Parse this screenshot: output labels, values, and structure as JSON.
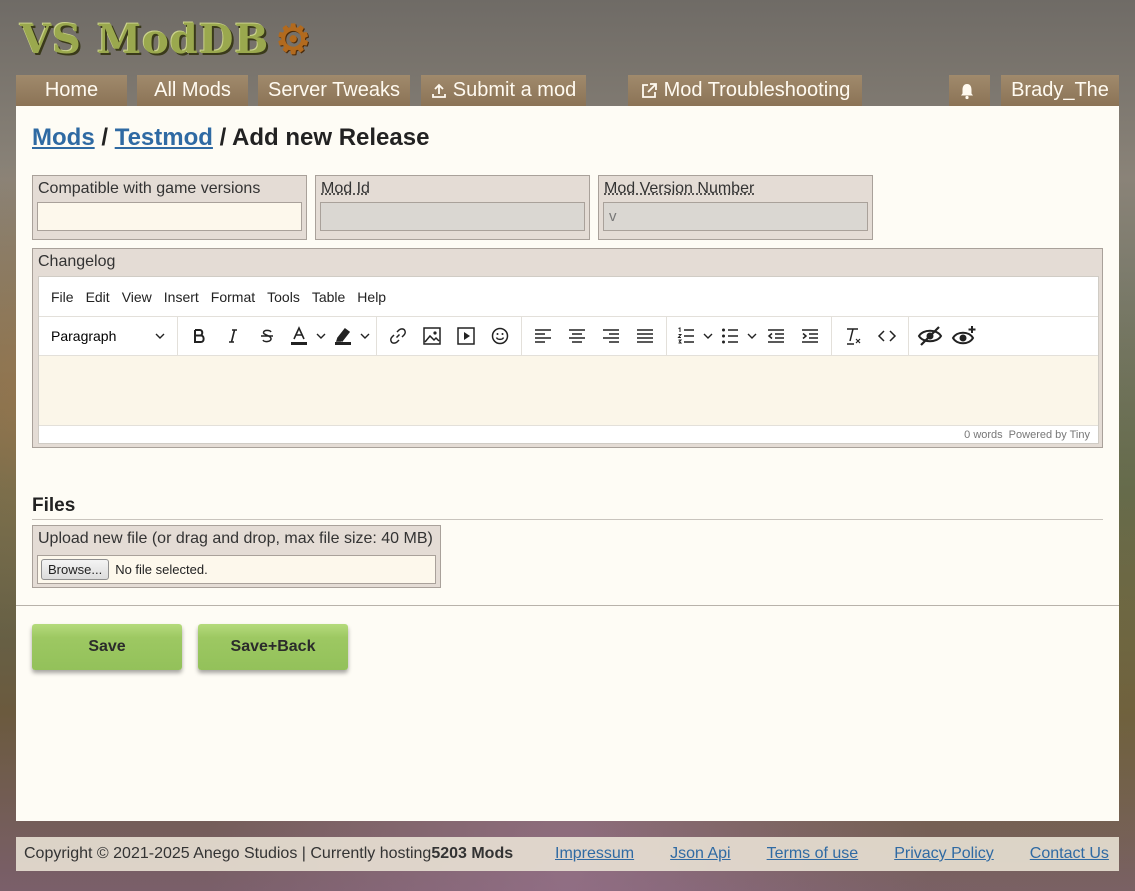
{
  "logo": {
    "text": "VS ModDB",
    "gear": "⚙"
  },
  "nav": {
    "home": "Home",
    "all_mods": "All Mods",
    "server_tweaks": "Server Tweaks",
    "submit_mod": "Submit a mod",
    "troubleshooting": "Mod Troubleshooting",
    "username": "Brady_The"
  },
  "breadcrumb": {
    "mods": "Mods",
    "sep1": " / ",
    "testmod": "Testmod",
    "sep2": " / ",
    "current": "Add new Release"
  },
  "form": {
    "game_versions_label": "Compatible with game versions",
    "game_versions_value": "",
    "mod_id_label": "Mod Id",
    "mod_id_value": "",
    "mod_version_label": "Mod Version Number",
    "mod_version_value": "v"
  },
  "editor": {
    "label": "Changelog",
    "menu": [
      "File",
      "Edit",
      "View",
      "Insert",
      "Format",
      "Tools",
      "Table",
      "Help"
    ],
    "block_format": "Paragraph",
    "word_count": "0 words",
    "powered_by": "Powered by Tiny"
  },
  "files": {
    "title": "Files",
    "upload_label": "Upload new file (or drag and drop, max file size: 40 MB)",
    "browse_label": "Browse...",
    "no_file": "No file selected."
  },
  "actions": {
    "save": "Save",
    "save_back": "Save+Back"
  },
  "footer": {
    "copyright": "Copyright © 2021-2025 Anego Studios | Currently hosting ",
    "mod_count": "5203 Mods",
    "links": [
      "Impressum",
      "Json Api",
      "Terms of use",
      "Privacy Policy",
      "Contact Us"
    ]
  },
  "colors": {
    "accent_link": "#2f6aa3",
    "button_green": "#9dc862",
    "nav_bg": "#8b7356"
  }
}
